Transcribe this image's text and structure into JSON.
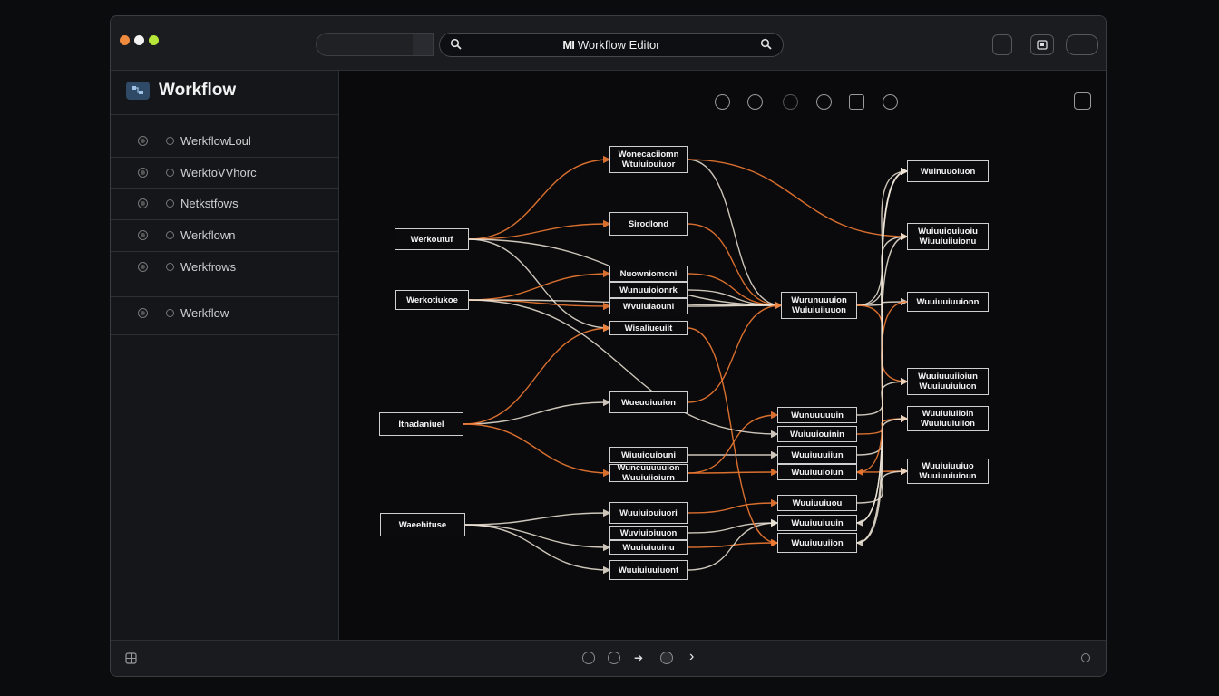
{
  "window": {
    "app_title_prefix": "MI",
    "app_title": "Workflow Editor"
  },
  "sidebar": {
    "brand": "Workflow",
    "items": [
      {
        "label": "WerkflowLoul"
      },
      {
        "label": "WerktoVVhorc"
      },
      {
        "label": "Netkstfows"
      },
      {
        "label": "Werkflown"
      },
      {
        "label": "Werkfrows"
      },
      {
        "label": "Werkflow"
      }
    ]
  },
  "colors": {
    "accent_orange": "#f07a32",
    "edge_light": "#efe6d8",
    "node_border": "#cfcfcf"
  },
  "nodes": [
    {
      "id": "n1",
      "label": "Werkoutuf"
    },
    {
      "id": "n2",
      "label": "Werkotiukoe"
    },
    {
      "id": "n3",
      "label": "Itnadaniuel"
    },
    {
      "id": "n4",
      "label": "Waeehituse"
    },
    {
      "id": "c1",
      "label": "Wonecaciiomn\nWtuiuiouiuor"
    },
    {
      "id": "c2",
      "label": "Sirodlond"
    },
    {
      "id": "c3",
      "label": "Nuowniomoni"
    },
    {
      "id": "c4",
      "label": "Wunuuioionrk"
    },
    {
      "id": "c5",
      "label": "Wvuiuiaouni"
    },
    {
      "id": "c6",
      "label": "Wisaliueuiit"
    },
    {
      "id": "c7",
      "label": "Wueuoiuuion"
    },
    {
      "id": "c8",
      "label": "Wiuuiouiouni"
    },
    {
      "id": "c9",
      "label": "Wuncuuuuuion\nWuuiuiioiurn"
    },
    {
      "id": "c10",
      "label": "Wuuiuiouiuori"
    },
    {
      "id": "c11",
      "label": "Wuviuioiuuon"
    },
    {
      "id": "c12",
      "label": "Wuuiuiuuinu"
    },
    {
      "id": "c13",
      "label": "Wuuiuiuuiuont"
    },
    {
      "id": "h1",
      "label": "Wurunuuuion\nWuiuiuiiuuon"
    },
    {
      "id": "r1",
      "label": "Wunuuuuuin"
    },
    {
      "id": "r2",
      "label": "Wuiuuiouinin"
    },
    {
      "id": "r3",
      "label": "Wuuiuuuiiun"
    },
    {
      "id": "r4",
      "label": "Wuuiuuioiun"
    },
    {
      "id": "r5",
      "label": "Wuuiuuiuou"
    },
    {
      "id": "r6",
      "label": "Wuuiuuiuuin"
    },
    {
      "id": "r7",
      "label": "Wuuiuuuiion"
    },
    {
      "id": "f1",
      "label": "Wuinuuoiuon"
    },
    {
      "id": "f2",
      "label": "Wuiuuiouiuoiu\nWiuuiuiiuionu"
    },
    {
      "id": "f3",
      "label": "Wuuiuuiuuionn"
    },
    {
      "id": "f4",
      "label": "Wuuiuuuiioiun\nWuuiuuiuiuon"
    },
    {
      "id": "f5",
      "label": "Wuuiuiuiioin\nWuuiuuiuiion"
    },
    {
      "id": "f6",
      "label": "Wuuiuiuuiuo\nWuuiuuiuioun"
    }
  ]
}
